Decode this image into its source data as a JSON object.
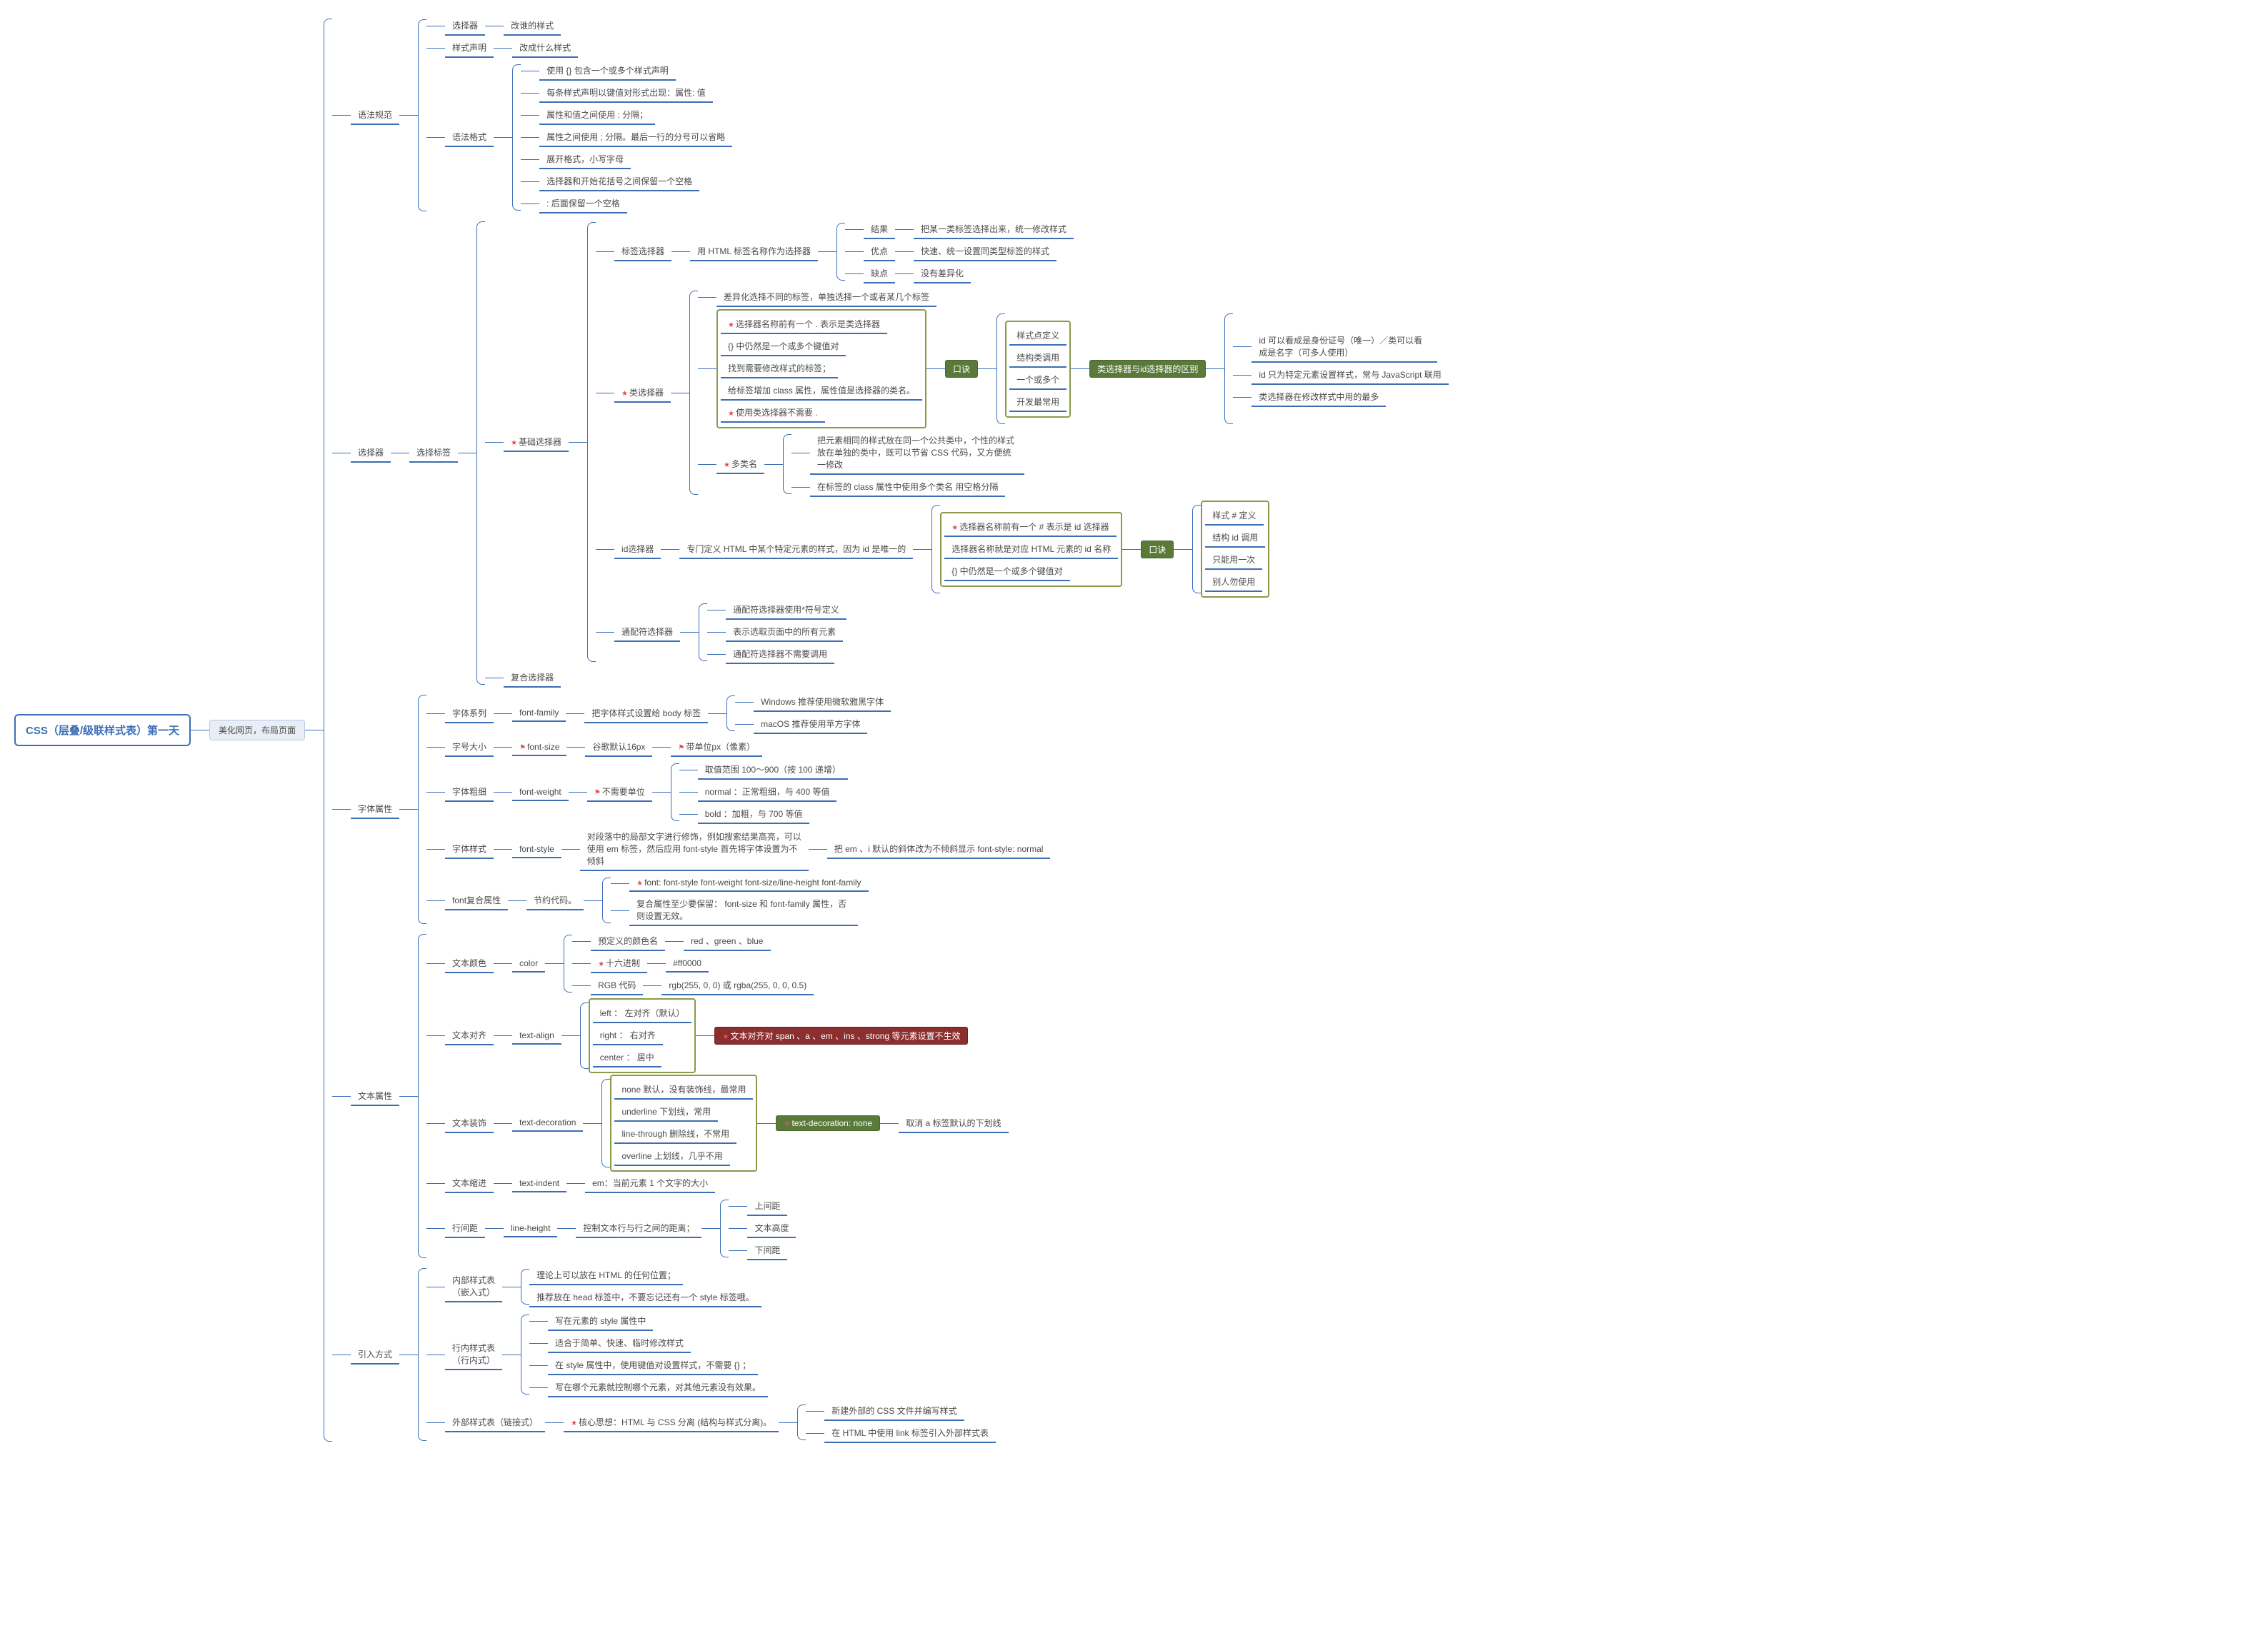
{
  "root": "CSS（层叠/级联样式表）第一天",
  "sub1": "美化网页，布局页面",
  "n": {
    "syntax": "语法规范",
    "selector_desc": "选择器",
    "whose_style": "改谁的样式",
    "style_decl": "样式声明",
    "change_style": "改成什么样式",
    "format": "语法格式",
    "f1": "使用 {} 包含一个或多个样式声明",
    "f2": "每条样式声明以键值对形式出现：属性: 值",
    "f3": "属性和值之间使用 : 分隔；",
    "f4": "属性之间使用 ; 分隔。最后一行的分号可以省略",
    "f5": "展开格式，小写字母",
    "f6": "选择器和开始花括号之间保留一个空格",
    "f7": ": 后面保留一个空格",
    "selectors_title": "选择器",
    "select_tag": "选择标签",
    "base_sel": "基础选择器",
    "tag_sel": "标签选择器",
    "tag_sel_desc": "用 HTML 标签名称作为选择器",
    "ts_r1a": "结果",
    "ts_r1b": "把某一类标签选择出来，统一修改样式",
    "ts_r2a": "优点",
    "ts_r2b": "快速、统一设置同类型标签的样式",
    "ts_r3a": "缺点",
    "ts_r3b": "没有差异化",
    "diff_sel": "差异化选择不同的标签，单独选择一个或者某几个标签",
    "class_sel": "类选择器",
    "cs1": "选择器名称前有一个 . 表示是类选择器",
    "cs2": "{} 中仍然是一个或多个键值对",
    "cs3": "找到需要修改样式的标签；",
    "cs4": "给标签增加 class 属性，属性值是选择器的类名。",
    "cs5": "使用类选择器不需要 .",
    "koujue": "口诀",
    "k1": "样式点定义",
    "k2": "结构类调用",
    "k3": "一个或多个",
    "k4": "开发最常用",
    "cls_vs_id": "类选择器与id选择器的区别",
    "cv1": "id 可以看成是身份证号（唯一）／类可以看成是名字（可多人使用）",
    "cv2": "id 只为特定元素设置样式，常与 JavaScript 联用",
    "cv3": "类选择器在修改样式中用的最多",
    "multi_title": "多类名",
    "m1": "把元素相同的样式放在同一个公共类中，个性的样式放在单独的类中，既可以节省 CSS 代码，又方便统一修改",
    "m2": "在标签的 class 属性中使用多个类名 用空格分隔",
    "id_sel": "id选择器",
    "id_desc": "专门定义 HTML 中某个特定元素的样式，因为 id 是唯一的",
    "id1": "选择器名称前有一个 # 表示是 id 选择器",
    "id2": "选择器名称就是对应 HTML 元素的 id 名称",
    "id3": "{} 中仍然是一个或多个键值对",
    "ik1": "样式 # 定义",
    "ik2": "结构 id 调用",
    "ik3": "只能用一次",
    "ik4": "别人勿使用",
    "wild_sel": "通配符选择器",
    "w1": "通配符选择器使用*符号定义",
    "w2": "表示选取页面中的所有元素",
    "w3": "通配符选择器不需要调用",
    "comp_sel": "复合选择器",
    "font_props": "字体属性",
    "fam": "字体系列",
    "fam_en": "font-family",
    "fam_desc": "把字体样式设置给 body 标签",
    "fam_win": "Windows 推荐使用微软雅黑字体",
    "fam_mac": "macOS 推荐使用苹方字体",
    "size": "字号大小",
    "size_en": "font-size",
    "size_desc": "谷歌默认16px",
    "size_unit": "带单位px（像素）",
    "weight": "字体粗细",
    "weight_en": "font-weight",
    "weight_nounit": "不需要单位",
    "w_range": "取值范围 100～900（按 100 递增）",
    "w_normal": "normal ：正常粗细，与 400 等值",
    "w_bold": "bold ：加粗，与 700 等值",
    "style": "字体样式",
    "style_en": "font-style",
    "style_desc": "对段落中的局部文字进行修饰，例如搜索结果高亮，可以使用 em 标签，然后应用 font-style 首先将字体设置为不倾斜",
    "style_note": "把 em 、i 默认的斜体改为不倾斜显示 font-style: normal",
    "font_comp": "font复合属性",
    "font_comp_desc": "节约代码。",
    "fc1": "font: font-style font-weight font-size/line-height font-family",
    "fc2": "复合属性至少要保留： font-size 和 font-family 属性，否则设置无效。",
    "text_props": "文本属性",
    "color": "文本颜色",
    "color_en": "color",
    "c1a": "预定义的颜色名",
    "c1b": "red 、green 、blue",
    "c2a": "十六进制",
    "c2b": "#ff0000",
    "c3a": "RGB 代码",
    "c3b": "rgb(255, 0, 0) 或 rgba(255, 0, 0, 0.5)",
    "align": "文本对齐",
    "align_en": "text-align",
    "a1": "left ： 左对齐（默认）",
    "a2": "right ： 右对齐",
    "a3": "center ： 居中",
    "align_note": "文本对齐对 span 、a 、em 、ins 、strong 等元素设置不生效",
    "deco": "文本装饰",
    "deco_en": "text-decoration",
    "d1": "none 默认，没有装饰线，最常用",
    "d2": "underline 下划线，常用",
    "d3": "line-through 删除线，不常用",
    "d4": "overline 上划线，几乎不用",
    "deco_g": "text-decoration: none",
    "deco_note": "取消 a 标签默认的下划线",
    "indent": "文本缩进",
    "indent_en": "text-indent",
    "indent_desc": "em：当前元素 1 个文字的大小",
    "lh": "行间距",
    "lh_en": "line-height",
    "lh_desc": "控制文本行与行之间的距离；",
    "lh1": "上间距",
    "lh2": "文本高度",
    "lh3": "下间距",
    "import": "引入方式",
    "internal": "内部样式表（嵌入式）",
    "in1": "理论上可以放在 HTML 的任何位置；",
    "in2": "推荐放在 head 标签中，不要忘记还有一个 style 标签哦。",
    "inline": "行内样式表（行内式）",
    "il1": "写在元素的 style 属性中",
    "il2": "适合于简单、快速、临时修改样式",
    "il3": "在 style 属性中，使用键值对设置样式，不需要 {} ；",
    "il4": "写在哪个元素就控制哪个元素，对其他元素没有效果。",
    "external": "外部样式表（链接式）",
    "ex_core": "核心思想：HTML 与 CSS 分离 (结构与样式分离)。",
    "e1": "新建外部的 CSS 文件并编写样式",
    "e2": "在 HTML 中使用 link 标签引入外部样式表"
  }
}
